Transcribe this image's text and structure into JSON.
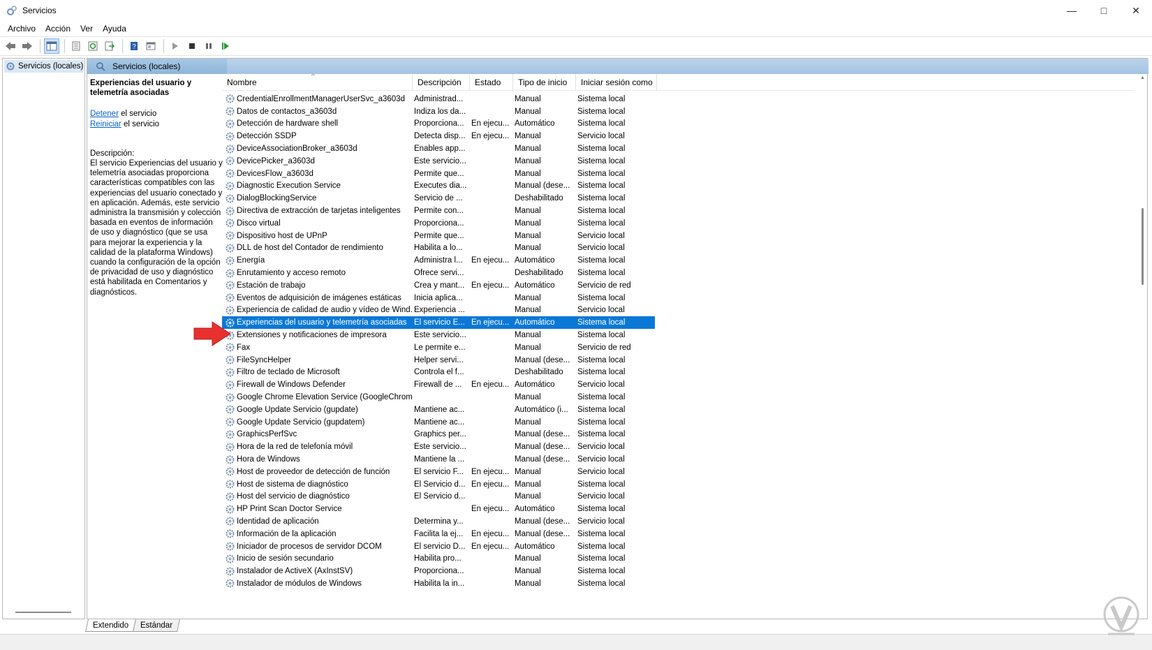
{
  "window": {
    "title": "Servicios",
    "minimize": "—",
    "maximize": "□",
    "close": "✕"
  },
  "menu": [
    "Archivo",
    "Acción",
    "Ver",
    "Ayuda"
  ],
  "tree": {
    "root_label": "Servicios (locales)"
  },
  "panel": {
    "header": "Servicios (locales)",
    "selected_title": "Experiencias del usuario y telemetría asociadas",
    "stop_link": "Detener",
    "stop_suffix": " el servicio",
    "restart_link": "Reiniciar",
    "restart_suffix": " el servicio",
    "description_label": "Descripción:",
    "description": "El servicio Experiencias del usuario y telemetría asociadas proporciona características compatibles con las experiencias del usuario conectado y en aplicación. Además, este servicio administra la transmisión y colección basada en eventos de información de uso y diagnóstico (que se usa para mejorar la experiencia y la calidad de la plataforma Windows) cuando la configuración de la opción de privacidad de uso y diagnóstico está habilitada en Comentarios y diagnósticos."
  },
  "columns": {
    "name": "Nombre",
    "description": "Descripción",
    "state": "Estado",
    "startup": "Tipo de inicio",
    "logon": "Iniciar sesión como"
  },
  "services": [
    {
      "name": "CredentialEnrollmentManagerUserSvc_a3603d",
      "desc": "Administrad...",
      "state": "",
      "startup": "Manual",
      "logon": "Sistema local"
    },
    {
      "name": "Datos de contactos_a3603d",
      "desc": "Indiza los da...",
      "state": "",
      "startup": "Manual",
      "logon": "Sistema local"
    },
    {
      "name": "Detección de hardware shell",
      "desc": "Proporciona...",
      "state": "En ejecu...",
      "startup": "Automático",
      "logon": "Sistema local"
    },
    {
      "name": "Detección SSDP",
      "desc": "Detecta disp...",
      "state": "En ejecu...",
      "startup": "Manual",
      "logon": "Servicio local"
    },
    {
      "name": "DeviceAssociationBroker_a3603d",
      "desc": "Enables app...",
      "state": "",
      "startup": "Manual",
      "logon": "Sistema local"
    },
    {
      "name": "DevicePicker_a3603d",
      "desc": "Este servicio...",
      "state": "",
      "startup": "Manual",
      "logon": "Sistema local"
    },
    {
      "name": "DevicesFlow_a3603d",
      "desc": "Permite que...",
      "state": "",
      "startup": "Manual",
      "logon": "Sistema local"
    },
    {
      "name": "Diagnostic Execution Service",
      "desc": "Executes dia...",
      "state": "",
      "startup": "Manual (dese...",
      "logon": "Sistema local"
    },
    {
      "name": "DialogBlockingService",
      "desc": "Servicio de ...",
      "state": "",
      "startup": "Deshabilitado",
      "logon": "Sistema local"
    },
    {
      "name": "Directiva de extracción de tarjetas inteligentes",
      "desc": "Permite con...",
      "state": "",
      "startup": "Manual",
      "logon": "Sistema local"
    },
    {
      "name": "Disco virtual",
      "desc": "Proporciona...",
      "state": "",
      "startup": "Manual",
      "logon": "Sistema local"
    },
    {
      "name": "Dispositivo host de UPnP",
      "desc": "Permite que...",
      "state": "",
      "startup": "Manual",
      "logon": "Servicio local"
    },
    {
      "name": "DLL de host del Contador de rendimiento",
      "desc": "Habilita a lo...",
      "state": "",
      "startup": "Manual",
      "logon": "Servicio local"
    },
    {
      "name": "Energía",
      "desc": "Administra l...",
      "state": "En ejecu...",
      "startup": "Automático",
      "logon": "Sistema local"
    },
    {
      "name": "Enrutamiento y acceso remoto",
      "desc": "Ofrece servi...",
      "state": "",
      "startup": "Deshabilitado",
      "logon": "Sistema local"
    },
    {
      "name": "Estación de trabajo",
      "desc": "Crea y mant...",
      "state": "En ejecu...",
      "startup": "Automático",
      "logon": "Servicio de red"
    },
    {
      "name": "Eventos de adquisición de imágenes estáticas",
      "desc": "Inicia aplica...",
      "state": "",
      "startup": "Manual",
      "logon": "Sistema local"
    },
    {
      "name": "Experiencia de calidad de audio y vídeo de Wind...",
      "desc": "Experiencia ...",
      "state": "",
      "startup": "Manual",
      "logon": "Servicio local"
    },
    {
      "name": "Experiencias del usuario y telemetría asociadas",
      "desc": "El servicio E...",
      "state": "En ejecu...",
      "startup": "Automático",
      "logon": "Sistema local",
      "selected": true
    },
    {
      "name": "Extensiones y notificaciones de impresora",
      "desc": "Este servicio...",
      "state": "",
      "startup": "Manual",
      "logon": "Sistema local"
    },
    {
      "name": "Fax",
      "desc": "Le permite e...",
      "state": "",
      "startup": "Manual",
      "logon": "Servicio de red"
    },
    {
      "name": "FileSyncHelper",
      "desc": "Helper servi...",
      "state": "",
      "startup": "Manual (dese...",
      "logon": "Sistema local"
    },
    {
      "name": "Filtro de teclado de Microsoft",
      "desc": "Controla el f...",
      "state": "",
      "startup": "Deshabilitado",
      "logon": "Sistema local"
    },
    {
      "name": "Firewall de Windows Defender",
      "desc": "Firewall de ...",
      "state": "En ejecu...",
      "startup": "Automático",
      "logon": "Servicio local"
    },
    {
      "name": "Google Chrome Elevation Service (GoogleChrom...",
      "desc": "",
      "state": "",
      "startup": "Manual",
      "logon": "Sistema local"
    },
    {
      "name": "Google Update Servicio (gupdate)",
      "desc": "Mantiene ac...",
      "state": "",
      "startup": "Automático (i...",
      "logon": "Sistema local"
    },
    {
      "name": "Google Update Servicio (gupdatem)",
      "desc": "Mantiene ac...",
      "state": "",
      "startup": "Manual",
      "logon": "Sistema local"
    },
    {
      "name": "GraphicsPerfSvc",
      "desc": "Graphics per...",
      "state": "",
      "startup": "Manual (dese...",
      "logon": "Sistema local"
    },
    {
      "name": "Hora de la red de telefonía móvil",
      "desc": "Este servicio...",
      "state": "",
      "startup": "Manual (dese...",
      "logon": "Servicio local"
    },
    {
      "name": "Hora de Windows",
      "desc": "Mantiene la ...",
      "state": "",
      "startup": "Manual (dese...",
      "logon": "Servicio local"
    },
    {
      "name": "Host de proveedor de detección de función",
      "desc": "El servicio F...",
      "state": "En ejecu...",
      "startup": "Manual",
      "logon": "Servicio local"
    },
    {
      "name": "Host de sistema de diagnóstico",
      "desc": "El Servicio d...",
      "state": "En ejecu...",
      "startup": "Manual",
      "logon": "Sistema local"
    },
    {
      "name": "Host del servicio de diagnóstico",
      "desc": "El Servicio d...",
      "state": "",
      "startup": "Manual",
      "logon": "Servicio local"
    },
    {
      "name": "HP Print Scan Doctor Service",
      "desc": "",
      "state": "En ejecu...",
      "startup": "Automático",
      "logon": "Sistema local"
    },
    {
      "name": "Identidad de aplicación",
      "desc": "Determina y...",
      "state": "",
      "startup": "Manual (dese...",
      "logon": "Servicio local"
    },
    {
      "name": "Información de la aplicación",
      "desc": "Facilita la ej...",
      "state": "En ejecu...",
      "startup": "Manual (dese...",
      "logon": "Sistema local"
    },
    {
      "name": "Iniciador de procesos de servidor DCOM",
      "desc": "El servicio D...",
      "state": "En ejecu...",
      "startup": "Automático",
      "logon": "Sistema local"
    },
    {
      "name": "Inicio de sesión secundario",
      "desc": "Habilita pro...",
      "state": "",
      "startup": "Manual",
      "logon": "Sistema local"
    },
    {
      "name": "Instalador de ActiveX (AxInstSV)",
      "desc": "Proporciona...",
      "state": "",
      "startup": "Manual",
      "logon": "Sistema local"
    },
    {
      "name": "Instalador de módulos de Windows",
      "desc": "Habilita la in...",
      "state": "",
      "startup": "Manual",
      "logon": "Sistema local"
    }
  ],
  "tabs": [
    "Extendido",
    "Estándar"
  ],
  "colors": {
    "selection": "#0a78d7",
    "header": "#9dbfe0",
    "link": "#0b62c9",
    "annotation_arrow": "#e8312f"
  }
}
